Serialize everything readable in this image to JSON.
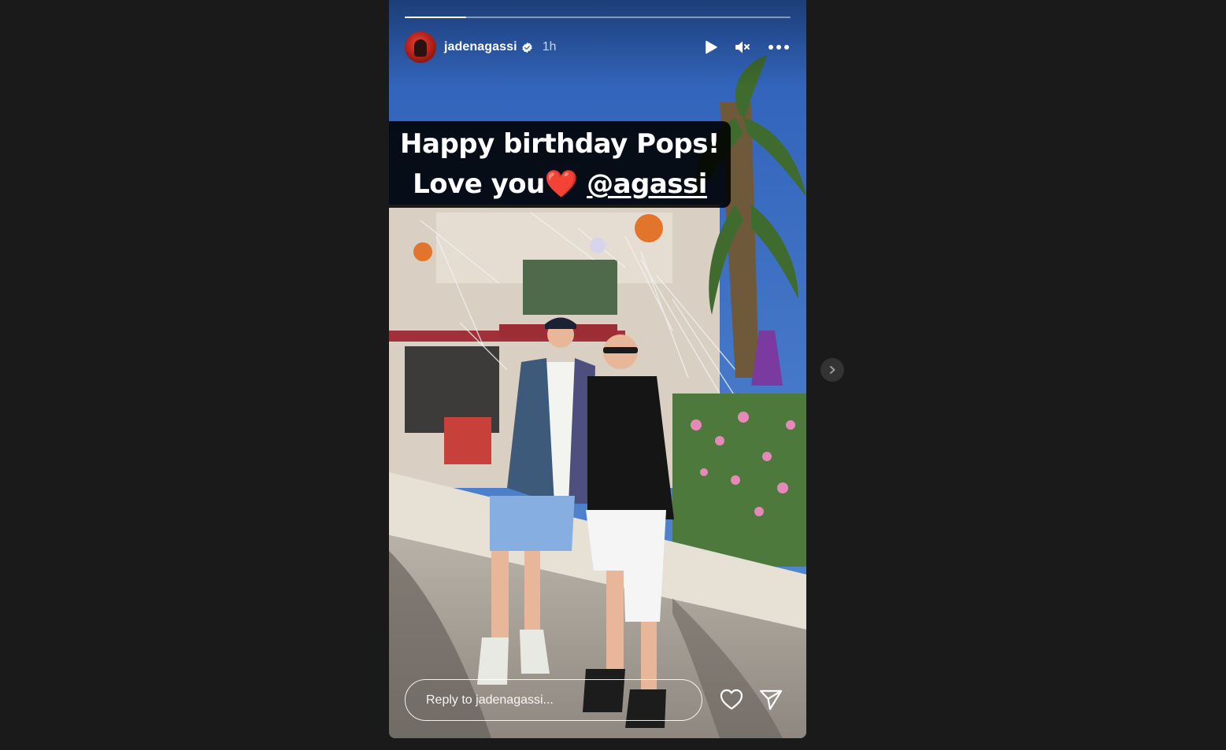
{
  "story": {
    "progress_fraction": 0.16,
    "username": "jadenagassi",
    "time": "1h",
    "verified": true,
    "caption_line1": "Happy birthday Pops!",
    "caption_line2_prefix": "Love you",
    "caption_heart": "❤️",
    "caption_mention": "@agassi",
    "reply_placeholder": "Reply to jadenagassi..."
  },
  "icons": {
    "avatar": "avatar",
    "verified": "verified-badge-icon",
    "play": "play-icon",
    "mute": "muted-speaker-icon",
    "more": "more-options-icon",
    "like": "heart-outline-icon",
    "share": "paper-plane-icon",
    "next": "chevron-right-icon"
  },
  "colors": {
    "page_bg": "#1a1a1a",
    "caption_bg": "#000000",
    "heart": "#e8232f"
  }
}
